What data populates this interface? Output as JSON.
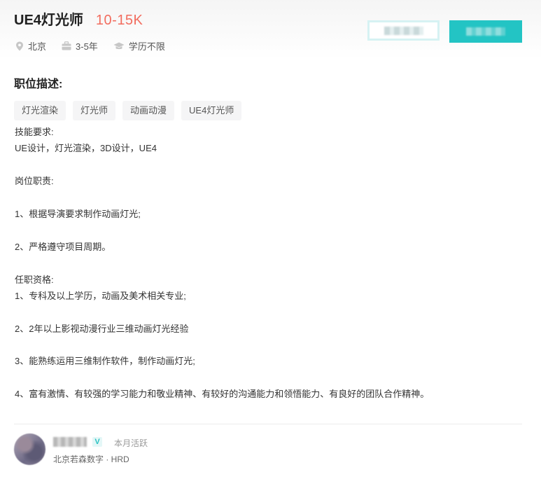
{
  "job": {
    "title": "UE4灯光师",
    "salary": "10-15K",
    "location": "北京",
    "experience": "3-5年",
    "education": "学历不限"
  },
  "icons": {
    "location": "location-pin-icon",
    "experience": "briefcase-icon",
    "education": "graduation-cap-icon"
  },
  "section_title": "职位描述:",
  "tags": [
    "灯光渲染",
    "灯光师",
    "动画动漫",
    "UE4灯光师"
  ],
  "description": [
    "技能要求:",
    "UE设计，灯光渲染，3D设计，UE4",
    "",
    "岗位职责:",
    "",
    "1、根据导演要求制作动画灯光;",
    "",
    "2、严格遵守项目周期。",
    "",
    "任职资格:",
    "1、专科及以上学历，动画及美术相关专业;",
    "",
    "2、2年以上影视动漫行业三维动画灯光经验",
    "",
    "3、能熟练运用三维制作软件，制作动画灯光;",
    "",
    "4、富有激情、有较强的学习能力和敬业精神、有较好的沟通能力和领悟能力、有良好的团队合作精神。"
  ],
  "recruiter": {
    "badge": "V",
    "status": "本月活跃",
    "company_role": "北京若森数字 · HRD"
  },
  "colors": {
    "salary": "#f26d5f",
    "accent": "#23c4c4"
  }
}
